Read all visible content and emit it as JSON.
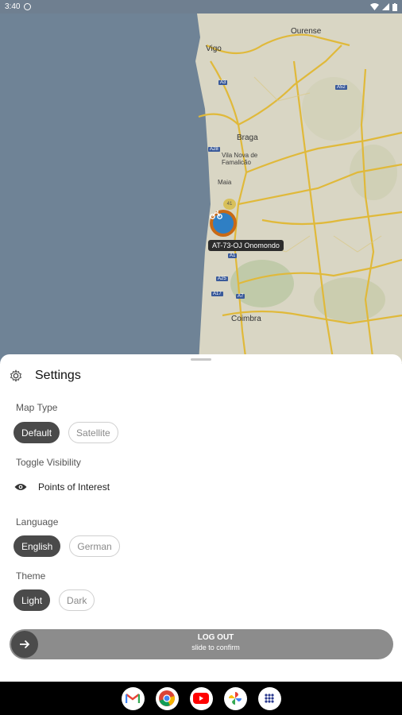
{
  "status_bar": {
    "time": "3:40"
  },
  "map": {
    "cities": [
      "Ourense",
      "Vigo",
      "Braga",
      "Vila Nova de Famalicão",
      "Coimbra",
      "Maia"
    ],
    "roads": [
      "A3",
      "A52",
      "A28",
      "A1",
      "A17",
      "A25",
      "A7"
    ],
    "vehicle_label": "AT-73-OJ  Onomondo",
    "cluster_count": "41"
  },
  "settings": {
    "title": "Settings",
    "map_type": {
      "label": "Map Type",
      "options": [
        "Default",
        "Satellite"
      ],
      "selected": "Default"
    },
    "toggle_visibility": {
      "label": "Toggle Visibility",
      "item": "Points of Interest"
    },
    "language": {
      "label": "Language",
      "options": [
        "English",
        "German"
      ],
      "selected": "English"
    },
    "theme": {
      "label": "Theme",
      "options": [
        "Light",
        "Dark"
      ],
      "selected": "Light"
    },
    "logout": {
      "title": "LOG OUT",
      "subtitle": "slide to confirm"
    }
  },
  "nav_apps": [
    "gmail-icon",
    "chrome-icon",
    "youtube-icon",
    "photos-icon",
    "app-drawer-icon"
  ],
  "colors": {
    "sea": "#6f8396",
    "land": "#d9d6c4",
    "road": "#e0b93a",
    "accent_dark": "#4a4a4a"
  }
}
